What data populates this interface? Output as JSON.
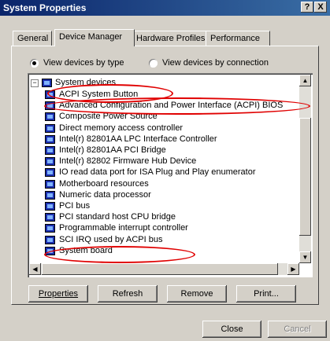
{
  "window": {
    "title": "System Properties"
  },
  "titlebar_buttons": {
    "help": "?",
    "close": "X"
  },
  "tabs": [
    "General",
    "Device Manager",
    "Hardware Profiles",
    "Performance"
  ],
  "view_options": {
    "by_type": "View devices by type",
    "by_connection": "View devices by connection"
  },
  "tree": {
    "root": "System devices",
    "items": [
      "ACPI System Button",
      "Advanced Configuration and Power Interface (ACPI) BIOS",
      "Composite Power Source",
      "Direct memory access controller",
      "Intel(r) 82801AA LPC Interface Controller",
      "Intel(r) 82801AA PCI Bridge",
      "Intel(r) 82802 Firmware Hub Device",
      "IO read data port for ISA Plug and Play enumerator",
      "Motherboard resources",
      "Numeric data processor",
      "PCI bus",
      "PCI standard host CPU bridge",
      "Programmable interrupt controller",
      "SCI IRQ used by ACPI bus",
      "System board"
    ]
  },
  "buttons": {
    "properties": "Properties",
    "refresh": "Refresh",
    "remove": "Remove",
    "print": "Print..."
  },
  "footer": {
    "close": "Close",
    "cancel": "Cancel"
  },
  "colors": {
    "title_bar": "#0a246a",
    "highlight_ellipse": "#e00000",
    "face": "#d4d0c8"
  }
}
